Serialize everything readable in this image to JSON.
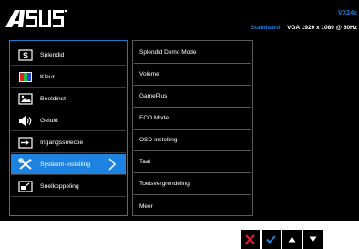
{
  "header": {
    "model": "VX24s",
    "mode": "Standaard",
    "resolution": "VGA 1920 x 1080 @ 60Hz"
  },
  "menu": {
    "items": [
      {
        "label": "Splendid",
        "icon": "splendid-icon"
      },
      {
        "label": "Kleur",
        "icon": "color-icon"
      },
      {
        "label": "Beeldinst",
        "icon": "image-icon"
      },
      {
        "label": "Geluid",
        "icon": "speaker-icon"
      },
      {
        "label": "Ingangsselectie",
        "icon": "input-icon"
      },
      {
        "label": "Systeem-instelling",
        "icon": "tools-icon",
        "selected": true
      },
      {
        "label": "Snelkoppeling",
        "icon": "shortcut-icon"
      }
    ]
  },
  "submenu": {
    "items": [
      {
        "label": "Splendid Demo Mode"
      },
      {
        "label": "Volume"
      },
      {
        "label": "GamePlus"
      },
      {
        "label": "ECO Mode"
      },
      {
        "label": "OSD-instelling"
      },
      {
        "label": "Taal"
      },
      {
        "label": "Toetsvergrendeling"
      },
      {
        "label": "Meer"
      }
    ]
  },
  "buttons": [
    {
      "icon": "close-icon",
      "color": "#e02020"
    },
    {
      "icon": "check-icon",
      "color": "#1e82e0"
    },
    {
      "icon": "up-icon",
      "color": "#ffffff"
    },
    {
      "icon": "down-icon",
      "color": "#ffffff"
    }
  ],
  "colors": {
    "accent": "#1e82e0",
    "panel": "#000000"
  }
}
